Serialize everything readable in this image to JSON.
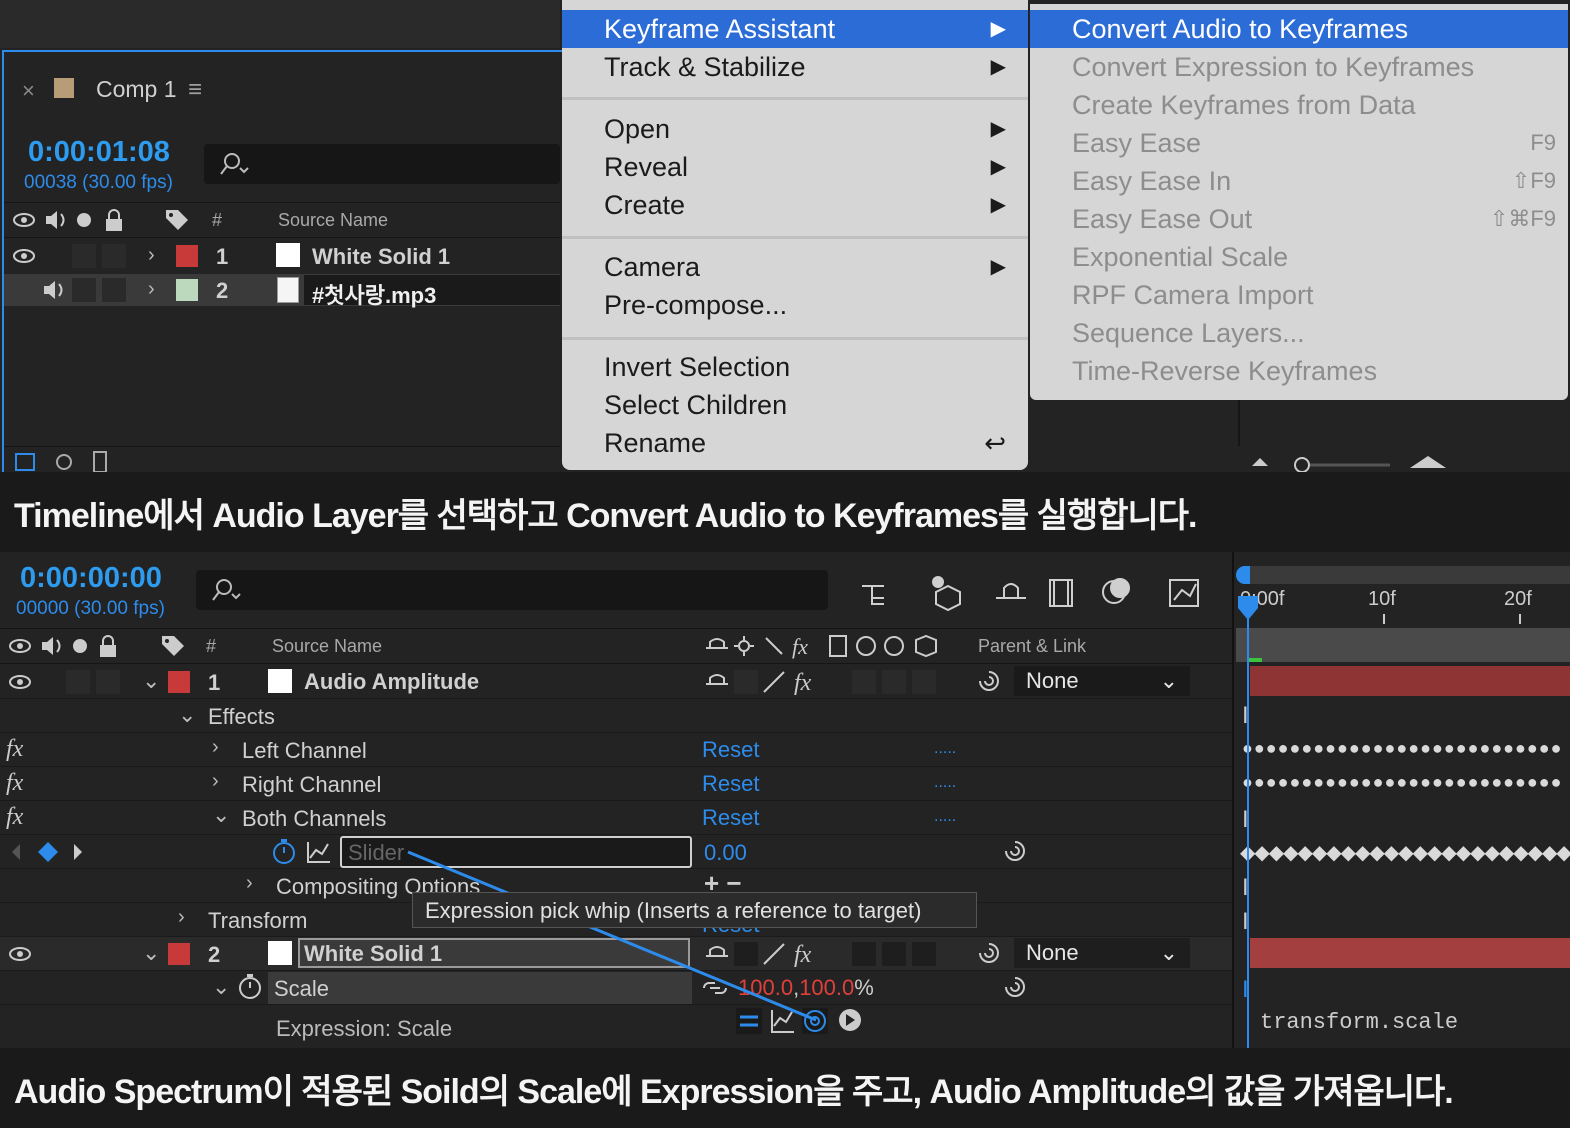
{
  "top_panel": {
    "tab_close": "×",
    "tab_title": "Comp 1",
    "tab_menu": "≡",
    "timecode": "0:00:01:08",
    "frames": "00038 (30.00 fps)",
    "header": {
      "num": "#",
      "source_name": "Source Name"
    },
    "layers": [
      {
        "index": "1",
        "name": "White Solid 1",
        "label_color": "#c83a3a"
      },
      {
        "index": "2",
        "name": "#첫사랑.mp3",
        "label_color": "#bcd9bd"
      }
    ]
  },
  "context_menu": {
    "items": [
      {
        "label": "Keyframe Assistant",
        "arrow": "▶"
      },
      {
        "label": "Track & Stabilize",
        "arrow": "▶"
      },
      {
        "label": "Open",
        "arrow": "▶"
      },
      {
        "label": "Reveal",
        "arrow": "▶"
      },
      {
        "label": "Create",
        "arrow": "▶"
      },
      {
        "label": "Camera",
        "arrow": "▶"
      },
      {
        "label": "Pre-compose...",
        "arrow": ""
      },
      {
        "label": "Invert Selection",
        "arrow": ""
      },
      {
        "label": "Select Children",
        "arrow": ""
      },
      {
        "label": "Rename",
        "arrow": "↩"
      }
    ]
  },
  "submenu": {
    "items": [
      {
        "label": "Convert Audio to Keyframes",
        "shortcut": ""
      },
      {
        "label": "Convert Expression to Keyframes",
        "shortcut": ""
      },
      {
        "label": "Create Keyframes from Data",
        "shortcut": ""
      },
      {
        "label": "Easy Ease",
        "shortcut": "F9"
      },
      {
        "label": "Easy Ease In",
        "shortcut": "⇧F9"
      },
      {
        "label": "Easy Ease Out",
        "shortcut": "⇧⌘F9"
      },
      {
        "label": "Exponential Scale",
        "shortcut": ""
      },
      {
        "label": "RPF Camera Import",
        "shortcut": ""
      },
      {
        "label": "Sequence Layers...",
        "shortcut": ""
      },
      {
        "label": "Time-Reverse Keyframes",
        "shortcut": ""
      }
    ]
  },
  "caption1": "Timeline에서 Audio Layer를 선택하고 Convert Audio to Keyframes를 실행합니다.",
  "caption2": "Audio Spectrum이 적용된 Soild의 Scale에 Expression을 주고, Audio Amplitude의 값을 가져옵니다.",
  "timeline": {
    "timecode": "0:00:00:00",
    "frames": "00000 (30.00 fps)",
    "header": {
      "num": "#",
      "source_name": "Source Name",
      "parent_link": "Parent & Link"
    },
    "ruler": [
      "0:00f",
      "10f",
      "20f"
    ],
    "layer1": {
      "index": "1",
      "name": "Audio Amplitude",
      "parent": "None",
      "label_color": "#c83a3a"
    },
    "effects_label": "Effects",
    "effects": [
      {
        "name": "Left Channel",
        "reset": "Reset",
        "dots": "....."
      },
      {
        "name": "Right Channel",
        "reset": "Reset",
        "dots": "....."
      },
      {
        "name": "Both Channels",
        "reset": "Reset",
        "dots": "....."
      }
    ],
    "slider": {
      "name": "Slider",
      "value": "0.00"
    },
    "compositing": "Compositing Options",
    "compositing_ops": "+ −",
    "transform": "Transform",
    "transform_reset": "Reset",
    "layer2": {
      "index": "2",
      "name": "White Solid 1",
      "parent": "None",
      "label_color": "#c83a3a"
    },
    "scale": {
      "name": "Scale",
      "value_x": "100.0",
      "comma": ",",
      "value_y": "100.0",
      "unit": "%"
    },
    "expression_label": "Expression: Scale",
    "expression_text": "transform.scale",
    "tooltip": "Expression pick whip (Inserts a reference to target)",
    "keyframe_pattern": "●●●●●●●●●●●●●●●●●●●●●●●●●●●",
    "diamond_pattern": "◆◆◆◆◆◆◆◆◆◆◆◆◆◆◆◆◆◆◆◆◆◆◆◆◆"
  }
}
